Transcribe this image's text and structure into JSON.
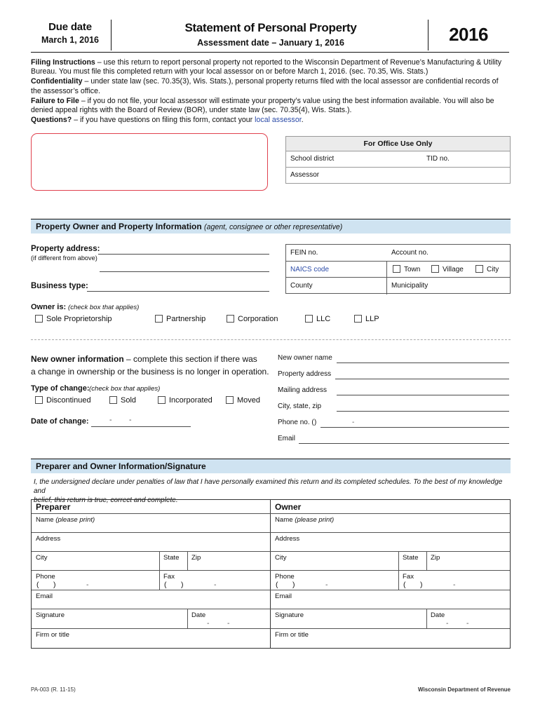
{
  "header": {
    "due_label": "Due date",
    "due_date": "March 1, 2016",
    "title": "Statement of Personal Property",
    "subtitle": "Assessment date – January 1, 2016",
    "year": "2016"
  },
  "instructions": {
    "filing_label": "Filing Instructions",
    "filing_text": " – use this return to report personal property not reported to the Wisconsin Department of Revenue’s Manufacturing & Utility Bureau.  You must file this completed return with your local assessor on or before March 1, 2016.  (sec. 70.35, Wis. Stats.)",
    "confidentiality_label": "Confidentiality",
    "confidentiality_text": " – under state law (sec. 70.35(3), Wis. Stats.), personal property returns filed with the local assessor are confidential records of the assessor’s office.",
    "failure_label": "Failure to File",
    "failure_text": " – if you do not file, your local assessor will estimate your property’s value using the best information available.  You will also be denied appeal rights with the Board of Review (BOR), under state law (sec. 70.35(4), Wis. Stats.).",
    "questions_label": "Questions?",
    "questions_text": " – if you have questions on filing this form, contact your ",
    "questions_link": "local assessor",
    "questions_end": "."
  },
  "office_use": {
    "title": "For Office Use Only",
    "school_district": "School district",
    "tid_no": "TID no.",
    "assessor": "Assessor"
  },
  "owner_section": {
    "band_title": "Property Owner and Property Information",
    "band_note": "(agent, consignee or other representative)",
    "property_address": "Property address:",
    "property_address_note": "(if different from above)",
    "business_type": "Business type:",
    "fein_no": "FEIN no.",
    "account_no": "Account no.",
    "naics_code": "NAICS code",
    "county": "County",
    "municipality": "Municipality",
    "muni_options": [
      "Town",
      "Village",
      "City"
    ],
    "owner_is_label": "Owner is:",
    "owner_is_note": "(check box that applies)",
    "owner_types": [
      "Sole Proprietorship",
      "Partnership",
      "Corporation",
      "LLC",
      "LLP"
    ]
  },
  "new_owner": {
    "heading_bold": "New owner information",
    "heading_rest": " – complete this section if there was",
    "heading_line2": "a change in ownership or the business is no longer in operation.",
    "type_of_change_label": "Type of change:",
    "type_of_change_note": "(check box that applies)",
    "change_types": [
      "Discontinued",
      "Sold",
      "Incorporated",
      "Moved"
    ],
    "date_of_change_label": "Date of change:",
    "date_separator": "-",
    "fields": [
      "New owner name",
      "Property address",
      "Mailing address",
      "City, state, zip",
      "Phone no.  (",
      "Email"
    ],
    "phone_paren_close": ")",
    "phone_dash": "-"
  },
  "preparer_section": {
    "band_title": "Preparer and Owner Information/Signature",
    "declaration_line1": "I, the undersigned declare under penalties of law that I have personally examined  this return and its completed schedules.  To the best of my knowledge and",
    "declaration_line2": "belief, this return is true, correct and complete.",
    "col_preparer": "Preparer",
    "col_owner": "Owner",
    "rows": {
      "name": "Name",
      "name_note": "(please print)",
      "address": "Address",
      "city": "City",
      "state": "State",
      "zip": "Zip",
      "phone": "Phone",
      "fax": "Fax",
      "email": "Email",
      "signature": "Signature",
      "date": "Date",
      "firm_or_title": "Firm or title",
      "paren_open": "(",
      "paren_close": ")",
      "dash": "-"
    }
  },
  "footer": {
    "form_no": "PA-003 (R. 11-15)",
    "agency": "Wisconsin Department of Revenue"
  },
  "colors": {
    "link": "#2b4ba8",
    "band": "#cfe3f1",
    "red_box": "#e0414e",
    "office_header": "#ebebeb"
  }
}
